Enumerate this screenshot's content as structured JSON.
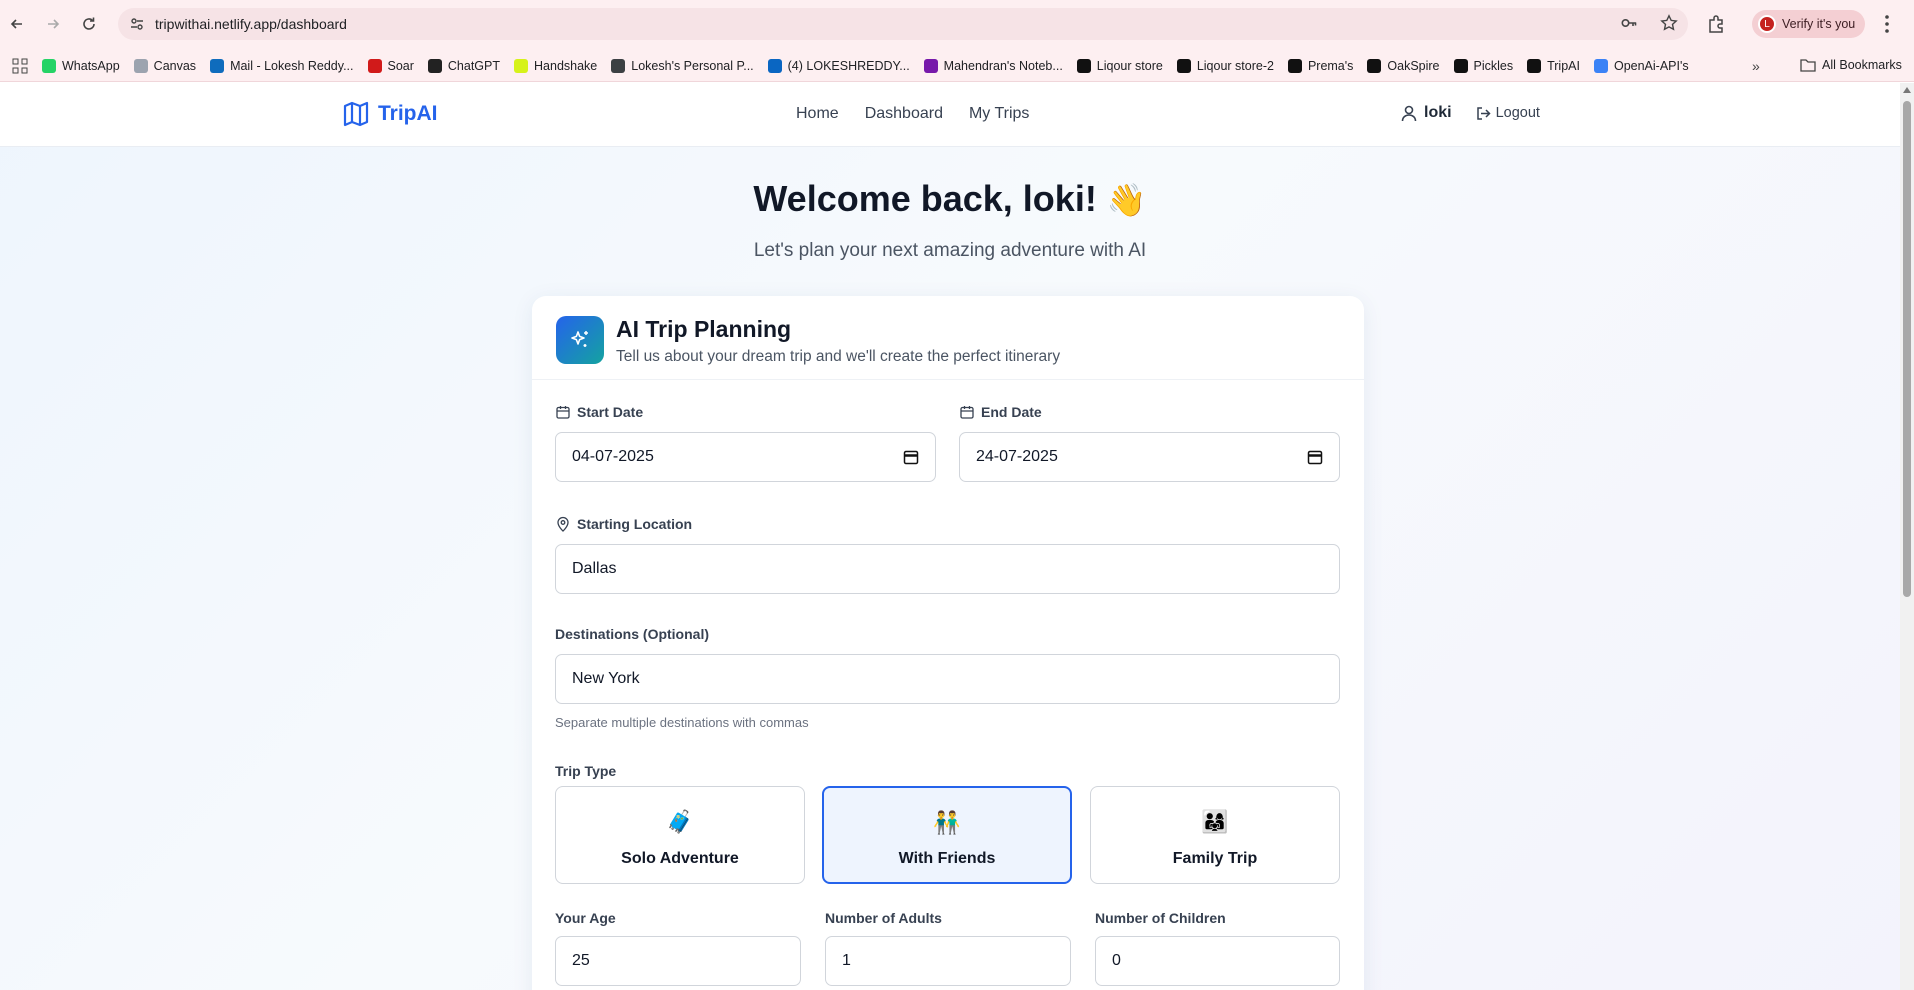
{
  "browser": {
    "url": "tripwithai.netlify.app/dashboard",
    "verify_label": "Verify it's you",
    "verify_avatar": "L",
    "bookmarks": [
      {
        "label": "WhatsApp",
        "icon": "whatsapp-icon",
        "color": "#25d366"
      },
      {
        "label": "Canvas",
        "icon": "canvas-icon",
        "color": "#9ca3af"
      },
      {
        "label": "Mail - Lokesh Reddy...",
        "icon": "outlook-icon",
        "color": "#0f6cbd"
      },
      {
        "label": "Soar",
        "icon": "soar-icon",
        "color": "#d11a1a"
      },
      {
        "label": "ChatGPT",
        "icon": "chatgpt-icon",
        "color": "#222222"
      },
      {
        "label": "Handshake",
        "icon": "handshake-icon",
        "color": "#d6f21a"
      },
      {
        "label": "Lokesh's Personal P...",
        "icon": "globe-icon",
        "color": "#3c4043"
      },
      {
        "label": "(4) LOKESHREDDY...",
        "icon": "linkedin-icon",
        "color": "#0a66c2"
      },
      {
        "label": "Mahendran's Noteb...",
        "icon": "onenote-icon",
        "color": "#7719aa"
      },
      {
        "label": "Liqour store",
        "icon": "bolt-icon",
        "color": "#111111"
      },
      {
        "label": "Liqour store-2",
        "icon": "bolt-icon",
        "color": "#111111"
      },
      {
        "label": "Prema's",
        "icon": "bolt-icon",
        "color": "#111111"
      },
      {
        "label": "OakSpire",
        "icon": "bolt-icon",
        "color": "#111111"
      },
      {
        "label": "Pickles",
        "icon": "bolt-icon",
        "color": "#111111"
      },
      {
        "label": "TripAI",
        "icon": "bolt-icon",
        "color": "#111111"
      },
      {
        "label": "OpenAi-API's",
        "icon": "openai-icon",
        "color": "#3b82f6"
      }
    ],
    "all_bookmarks_label": "All Bookmarks"
  },
  "header": {
    "brand": "TripAI",
    "nav": [
      "Home",
      "Dashboard",
      "My Trips"
    ],
    "username": "loki",
    "logout_label": "Logout"
  },
  "hero": {
    "title": "Welcome back, loki!",
    "wave_emoji": "👋",
    "subtitle": "Let's plan your next amazing adventure with AI"
  },
  "planner": {
    "title": "AI Trip Planning",
    "description": "Tell us about your dream trip and we'll create the perfect itinerary",
    "start_date": {
      "label": "Start Date",
      "value": "04-07-2025"
    },
    "end_date": {
      "label": "End Date",
      "value": "24-07-2025"
    },
    "starting_location": {
      "label": "Starting Location",
      "value": "Dallas"
    },
    "destinations": {
      "label": "Destinations (Optional)",
      "value": "New York",
      "hint": "Separate multiple destinations with commas"
    },
    "trip_type": {
      "label": "Trip Type",
      "options": [
        {
          "label": "Solo Adventure",
          "emoji": "🧳",
          "selected": false
        },
        {
          "label": "With Friends",
          "emoji": "👬",
          "selected": true
        },
        {
          "label": "Family Trip",
          "emoji": "👨‍👩‍👧",
          "selected": false
        }
      ]
    },
    "age": {
      "label": "Your Age",
      "value": "25"
    },
    "adults": {
      "label": "Number of Adults",
      "value": "1"
    },
    "children": {
      "label": "Number of Children",
      "value": "0"
    }
  },
  "colors": {
    "accent": "#2563eb",
    "chrome": "#fdeff1"
  }
}
